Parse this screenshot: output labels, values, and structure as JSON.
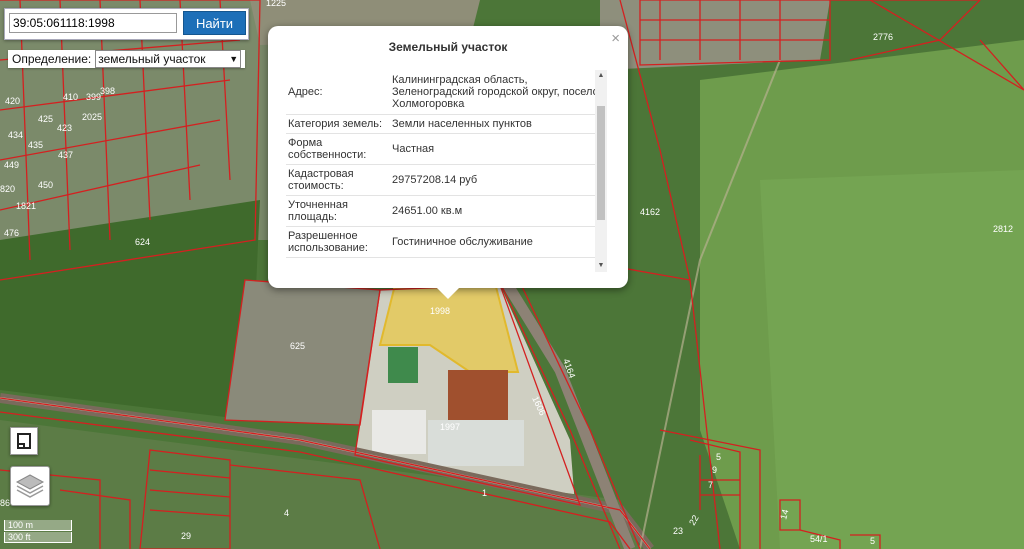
{
  "search": {
    "value": "39:05:061118:1998",
    "button_label": "Найти"
  },
  "definition": {
    "label": "Определение:",
    "selected": "земельный участок"
  },
  "popup": {
    "title": "Земельный участок",
    "close": "×",
    "rows": [
      {
        "key": "Адрес:",
        "value": "Калининградская область, Зеленоградский городской округ, поселок Холмогоровка"
      },
      {
        "key": "Категория земель:",
        "value": "Земли населенных пунктов"
      },
      {
        "key": "Форма собственности:",
        "value": "Частная"
      },
      {
        "key": "Кадастровая стоимость:",
        "value": "29757208.14 руб"
      },
      {
        "key": "Уточненная площадь:",
        "value": "24651.00 кв.м"
      },
      {
        "key": "Разрешенное использование:",
        "value": "Гостиничное обслуживание"
      }
    ]
  },
  "map": {
    "labels": {
      "p1998": "1998",
      "p1997": "1997",
      "p625": "625",
      "p624": "624",
      "p4162": "4162",
      "p2776": "2776",
      "p2812": "2812",
      "p1821": "1821",
      "p1": "1",
      "p4": "4",
      "p29": "29",
      "p4164": "4164",
      "p1606": "1606",
      "p5": "5",
      "p9": "9",
      "p7": "7",
      "p23": "23",
      "p22": "22",
      "p14": "14",
      "p54_1": "54/1",
      "p1225": "1225",
      "p420": "420",
      "p410": "410",
      "p399": "399",
      "p398": "398",
      "p434": "434",
      "p423": "423",
      "p435": "435",
      "p437": "437",
      "p449": "449",
      "p450": "450",
      "p820": "820",
      "p476": "476",
      "p2025": "2025",
      "p425": "425",
      "p86": "86",
      "p5a": "5"
    },
    "colors": {
      "parcel_border": "#d42020",
      "selected_fill": "#e8c84a",
      "vegetation": "#4f7a3a",
      "field": "#6c9a4a"
    }
  },
  "scale": {
    "metric": "100 m",
    "imperial": "300 ft"
  },
  "controls": {
    "measure_icon": "ruler-icon",
    "layers_icon": "layers-icon"
  }
}
